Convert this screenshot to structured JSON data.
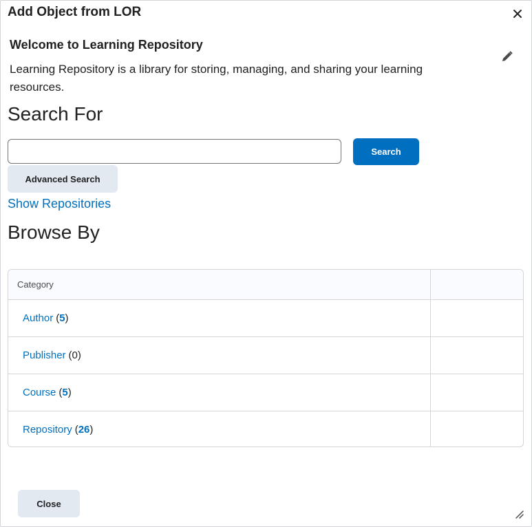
{
  "dialog": {
    "title": "Add Object from LOR",
    "close_icon": "close-icon"
  },
  "widget": {
    "title": "Welcome to Learning Repository",
    "description": "Learning Repository is a library for storing, managing, and sharing your learning resources.",
    "edit_icon": "pencil-icon"
  },
  "search": {
    "heading": "Search For",
    "value": "",
    "placeholder": "",
    "button_label": "Search",
    "advanced_label": "Advanced Search",
    "show_repositories": "Show Repositories"
  },
  "browse": {
    "heading": "Browse By",
    "column_header": "Category",
    "rows": [
      {
        "label": "Author",
        "count": "5",
        "count_linked": true
      },
      {
        "label": "Publisher",
        "count": "0",
        "count_linked": false
      },
      {
        "label": "Course",
        "count": "5",
        "count_linked": true
      },
      {
        "label": "Repository",
        "count": "26",
        "count_linked": true
      }
    ]
  },
  "footer": {
    "close_label": "Close",
    "resize_icon": "resize-grip-icon"
  },
  "colors": {
    "accent": "#006fbf",
    "secondary_button": "#e3e9f1",
    "border": "#d3d5d9"
  }
}
